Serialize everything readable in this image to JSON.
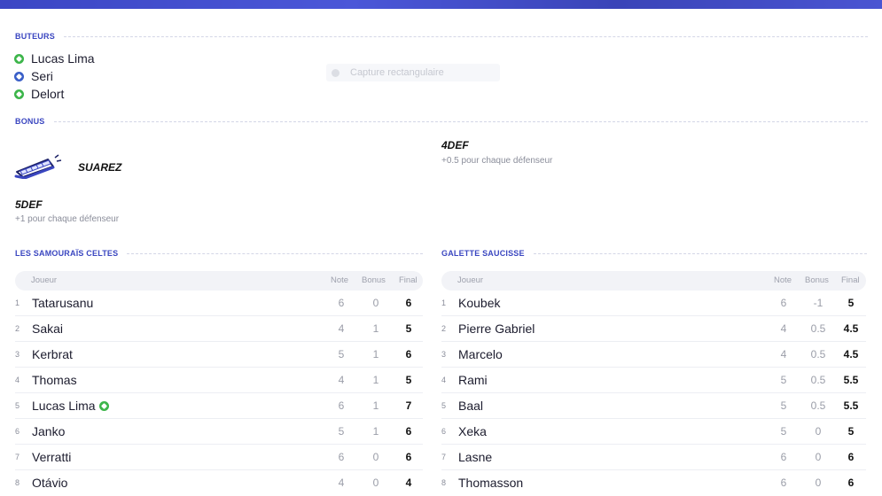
{
  "sections": {
    "scorers_title": "BUTEURS",
    "bonus_title": "BONUS"
  },
  "scorers": [
    {
      "name": "Lucas Lima",
      "ball_color": "#3cb54a"
    },
    {
      "name": "Seri",
      "ball_color": "#3a5fc8"
    },
    {
      "name": "Delort",
      "ball_color": "#3cb54a"
    }
  ],
  "capture_overlay": {
    "label": "Capture rectangulaire"
  },
  "bonuses": {
    "left": [
      {
        "name": "SUAREZ",
        "icon": "teeth-icon"
      },
      {
        "name": "5DEF",
        "desc": "+1 pour chaque défenseur"
      }
    ],
    "right": [
      {
        "name": "4DEF",
        "desc": "+0.5 pour chaque défenseur"
      }
    ]
  },
  "teams": [
    {
      "name": "LES SAMOURAÏS CELTES",
      "headers": {
        "player": "Joueur",
        "note": "Note",
        "bonus": "Bonus",
        "final": "Final"
      },
      "rows": [
        {
          "rank": "1",
          "name": "Tatarusanu",
          "note": "6",
          "bonus": "0",
          "final": "6"
        },
        {
          "rank": "2",
          "name": "Sakai",
          "note": "4",
          "bonus": "1",
          "final": "5"
        },
        {
          "rank": "3",
          "name": "Kerbrat",
          "note": "5",
          "bonus": "1",
          "final": "6"
        },
        {
          "rank": "4",
          "name": "Thomas",
          "note": "4",
          "bonus": "1",
          "final": "5"
        },
        {
          "rank": "5",
          "name": "Lucas Lima",
          "note": "6",
          "bonus": "1",
          "final": "7",
          "goal": true
        },
        {
          "rank": "6",
          "name": "Janko",
          "note": "5",
          "bonus": "1",
          "final": "6"
        },
        {
          "rank": "7",
          "name": "Verratti",
          "note": "6",
          "bonus": "0",
          "final": "6"
        },
        {
          "rank": "8",
          "name": "Otávio",
          "note": "4",
          "bonus": "0",
          "final": "4"
        }
      ]
    },
    {
      "name": "GALETTE SAUCISSE",
      "headers": {
        "player": "Joueur",
        "note": "Note",
        "bonus": "Bonus",
        "final": "Final"
      },
      "rows": [
        {
          "rank": "1",
          "name": "Koubek",
          "note": "6",
          "bonus": "-1",
          "final": "5"
        },
        {
          "rank": "2",
          "name": "Pierre Gabriel",
          "note": "4",
          "bonus": "0.5",
          "final": "4.5"
        },
        {
          "rank": "3",
          "name": "Marcelo",
          "note": "4",
          "bonus": "0.5",
          "final": "4.5"
        },
        {
          "rank": "4",
          "name": "Rami",
          "note": "5",
          "bonus": "0.5",
          "final": "5.5"
        },
        {
          "rank": "5",
          "name": "Baal",
          "note": "5",
          "bonus": "0.5",
          "final": "5.5"
        },
        {
          "rank": "6",
          "name": "Xeka",
          "note": "5",
          "bonus": "0",
          "final": "5"
        },
        {
          "rank": "7",
          "name": "Lasne",
          "note": "6",
          "bonus": "0",
          "final": "6"
        },
        {
          "rank": "8",
          "name": "Thomasson",
          "note": "6",
          "bonus": "0",
          "final": "6"
        }
      ]
    }
  ],
  "colors": {
    "accent": "#3a46c0",
    "goal_green": "#3cb54a",
    "goal_blue": "#3a5fc8"
  }
}
